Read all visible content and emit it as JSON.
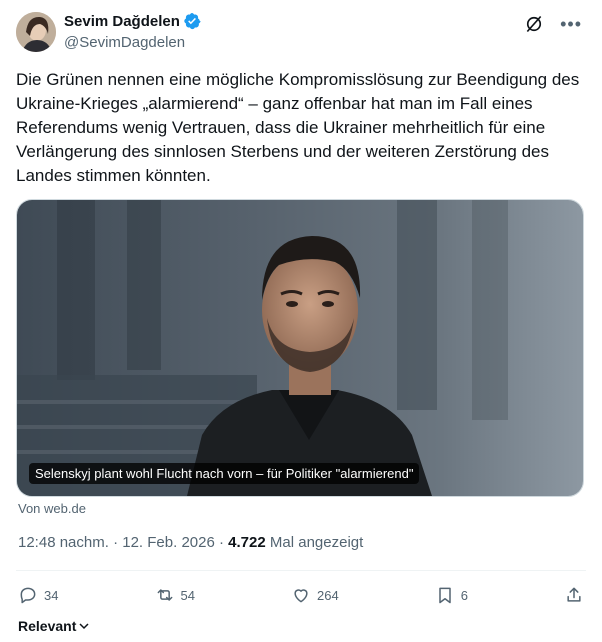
{
  "author": {
    "name": "Sevim Dağdelen",
    "handle": "@SevimDagdelen",
    "verified": true
  },
  "tweet": {
    "text": "Die Grünen nennen eine mögliche Kompromisslösung zur Beendigung des Ukraine-Krieges „alarmierend“ – ganz offenbar hat man im Fall eines Referendums wenig Vertrauen, dass die Ukrainer mehrheitlich für eine Verlängerung des sinnlosen Sterbens und der weiteren Zerstörung des Landes stimmen könnten."
  },
  "card": {
    "caption": "Selenskyj plant wohl Flucht nach vorn – für Politiker \"alarmierend\"",
    "source": "Von web.de"
  },
  "meta": {
    "time": "12:48 nachm.",
    "dot1": "·",
    "date": "12. Feb. 2026",
    "dot2": "·",
    "views_count": "4.722",
    "views_label": "Mal angezeigt"
  },
  "actions": {
    "replies": "34",
    "reposts": "54",
    "likes": "264",
    "bookmarks": "6"
  },
  "replies_sort": "Relevant",
  "colors": {
    "verified": "#1d9bf0",
    "secondary_text": "#536471",
    "primary_text": "#0f1419"
  }
}
